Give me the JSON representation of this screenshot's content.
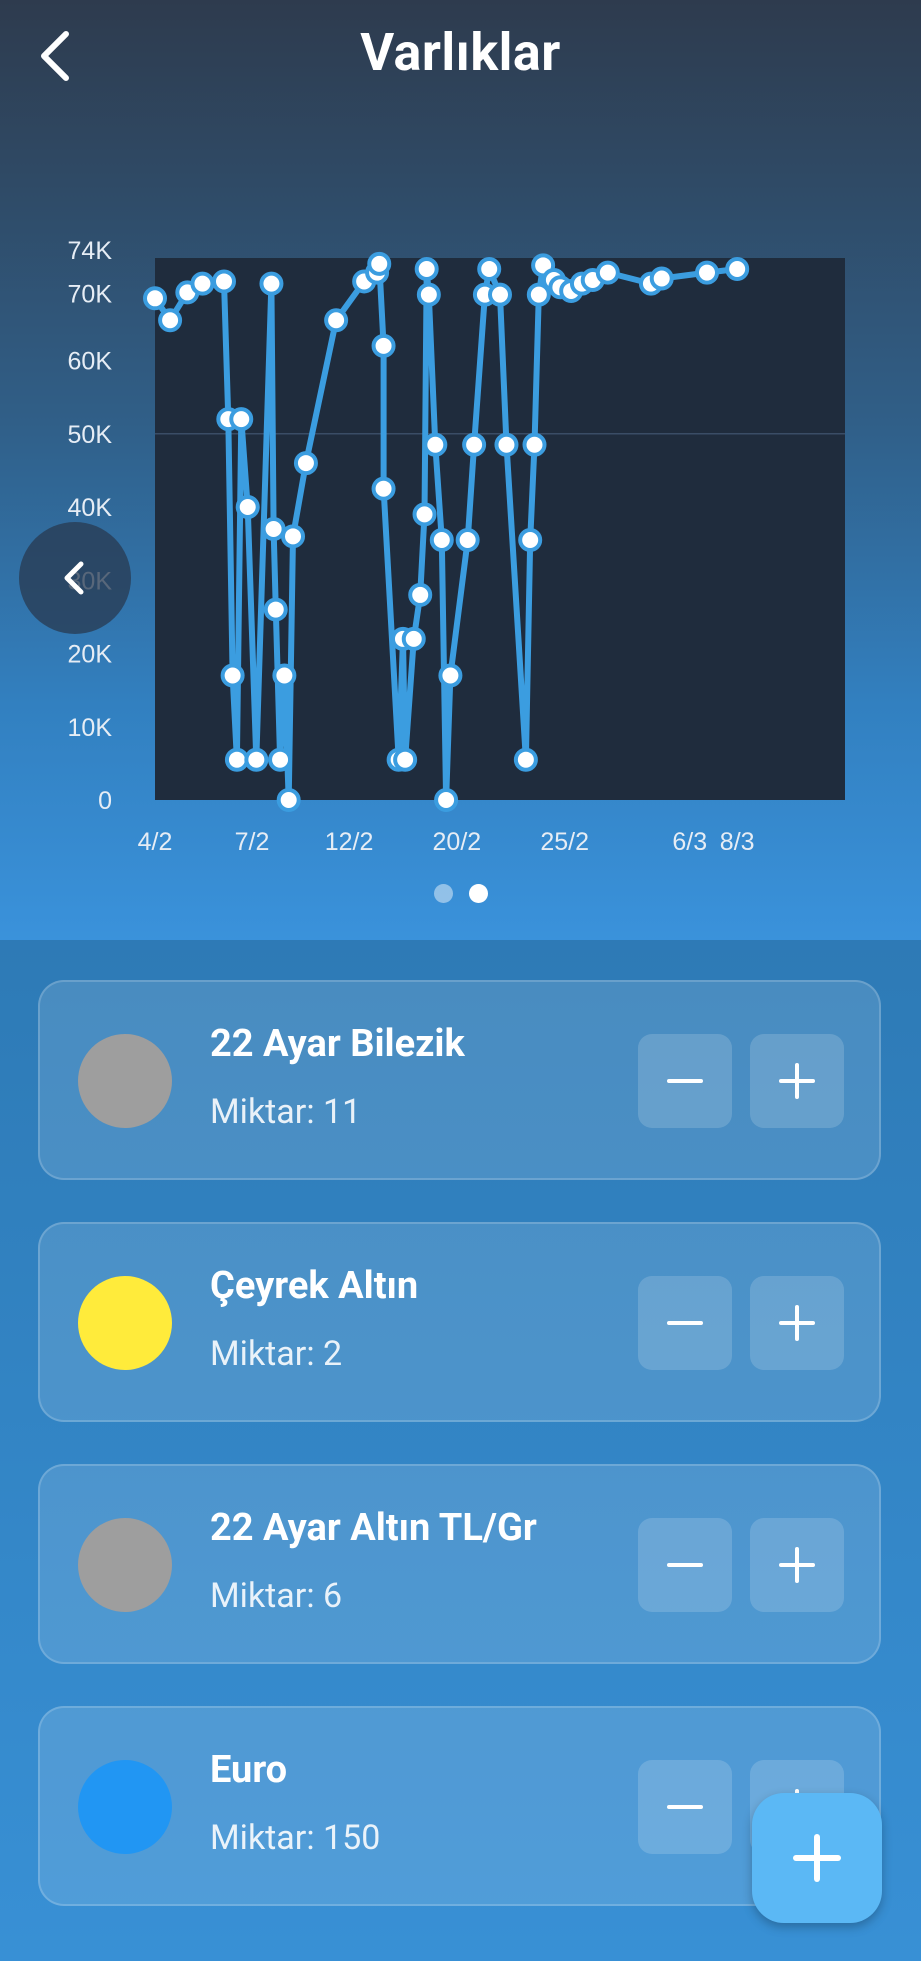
{
  "header": {
    "title": "Varlıklar"
  },
  "icons": {
    "back": "chevron-left-icon",
    "chart_prev": "chevron-left-icon",
    "add": "plus-icon",
    "increment": "plus-icon",
    "decrement": "minus-icon"
  },
  "colors": {
    "line": "#3b9de0",
    "plot_background": "#1f2c3d",
    "point_fill": "#ffffff"
  },
  "chart_data": {
    "type": "line",
    "title": "",
    "xlabel": "",
    "ylabel": "",
    "ylim": [
      0,
      74000
    ],
    "xlim": [
      4,
      36
    ],
    "y_ticks": [
      "0",
      "10K",
      "20K",
      "30K",
      "40K",
      "50K",
      "60K",
      "70K",
      "74K"
    ],
    "y_tick_values": [
      0,
      10000,
      20000,
      30000,
      40000,
      50000,
      60000,
      70000,
      74000
    ],
    "x_ticks": [
      "4/2",
      "7/2",
      "12/2",
      "20/2",
      "25/2",
      "6/3",
      "8/3"
    ],
    "x_tick_values": [
      4,
      8.5,
      13,
      18,
      23,
      28.8,
      31
    ],
    "grid": "horizontal at 50K",
    "legend": "none",
    "series": [
      {
        "x": [
          4,
          4.7,
          5.5,
          6.2,
          7.2,
          7.4,
          7.6,
          7.8,
          8.0,
          8.3,
          8.7,
          9.4,
          9.5,
          9.6,
          9.8,
          10.0,
          10.2,
          10.4,
          11.0,
          12.4,
          13.7,
          14.3,
          14.4,
          14.6,
          14.6,
          15.3,
          15.5,
          15.6,
          16.0,
          16.3,
          16.5,
          16.6,
          16.7,
          17.0,
          17.3,
          17.5,
          17.7,
          18.5,
          18.8,
          19.3,
          19.5,
          20.0,
          20.3,
          21.2,
          21.4,
          21.6,
          21.8,
          22.0,
          22.5,
          22.8,
          23.3,
          23.8,
          24.3,
          25.0,
          27.0,
          27.5,
          29.6,
          31.0
        ],
        "values": [
          68500,
          65500,
          69300,
          70500,
          70800,
          52000,
          17000,
          5500,
          52000,
          40000,
          5500,
          70500,
          37000,
          26000,
          5500,
          17000,
          0,
          36000,
          46000,
          65500,
          70800,
          72000,
          73200,
          62000,
          42500,
          5500,
          22000,
          5500,
          22000,
          28000,
          39000,
          72500,
          69000,
          48500,
          35500,
          0,
          17000,
          35500,
          48500,
          69000,
          72500,
          69000,
          48500,
          5500,
          35500,
          48500,
          69000,
          73000,
          71000,
          70000,
          69500,
          70500,
          71000,
          72000,
          70500,
          71200,
          72000,
          72500
        ]
      }
    ]
  },
  "pager": {
    "count": 2,
    "active_index": 1
  },
  "assets": [
    {
      "name": "22 Ayar Bilezik",
      "quantity": "Miktar: 11",
      "color": "#9e9e9e"
    },
    {
      "name": "Çeyrek Altın",
      "quantity": "Miktar: 2",
      "color": "#ffeb3b"
    },
    {
      "name": "22 Ayar Altın TL/Gr",
      "quantity": "Miktar: 6",
      "color": "#9e9e9e"
    },
    {
      "name": "Euro",
      "quantity": "Miktar: 150",
      "color": "#2196f3"
    }
  ]
}
